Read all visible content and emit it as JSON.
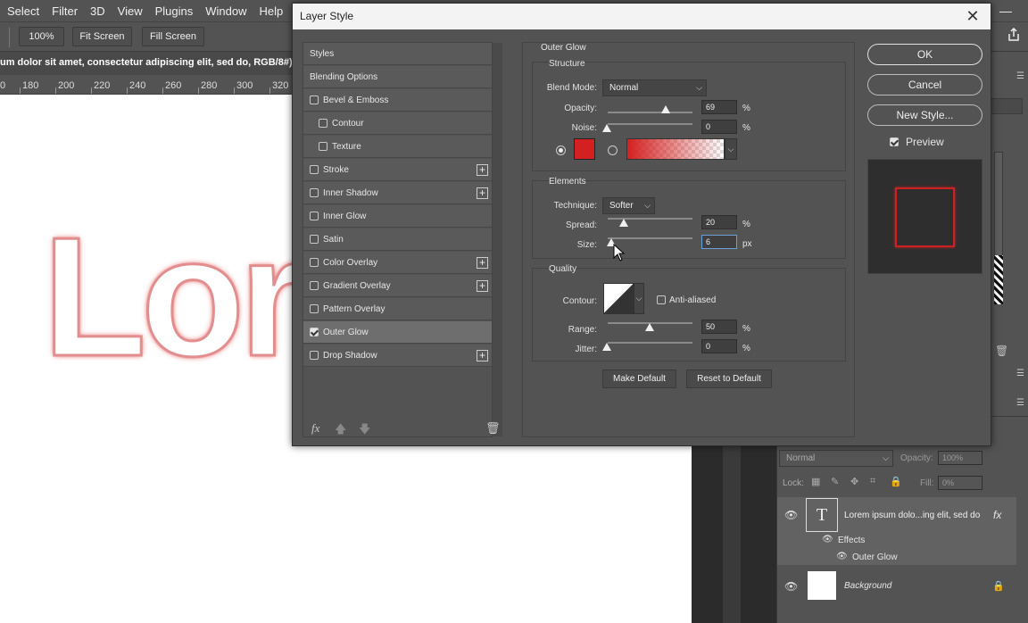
{
  "menu": [
    "Select",
    "Filter",
    "3D",
    "View",
    "Plugins",
    "Window",
    "Help"
  ],
  "options_bar": {
    "zoom": "100%",
    "fit_screen": "Fit Screen",
    "fill_screen": "Fill Screen"
  },
  "document_tab": "um dolor sit amet, consectetur adipiscing elit, sed do, RGB/8#) *",
  "ruler": [
    "0",
    "180",
    "200",
    "220",
    "240",
    "260",
    "280",
    "300",
    "320"
  ],
  "canvas_text": "Lor",
  "dialog": {
    "title": "Layer Style",
    "close": "✕",
    "styles": [
      {
        "label": "Styles",
        "checkbox": null,
        "plus": false,
        "indent": false,
        "selected": false
      },
      {
        "label": "Blending Options",
        "checkbox": null,
        "plus": false,
        "indent": false,
        "selected": false
      },
      {
        "label": "Bevel & Emboss",
        "checkbox": false,
        "plus": false,
        "indent": false,
        "selected": false
      },
      {
        "label": "Contour",
        "checkbox": false,
        "plus": false,
        "indent": true,
        "selected": false
      },
      {
        "label": "Texture",
        "checkbox": false,
        "plus": false,
        "indent": true,
        "selected": false
      },
      {
        "label": "Stroke",
        "checkbox": false,
        "plus": true,
        "indent": false,
        "selected": false
      },
      {
        "label": "Inner Shadow",
        "checkbox": false,
        "plus": true,
        "indent": false,
        "selected": false
      },
      {
        "label": "Inner Glow",
        "checkbox": false,
        "plus": false,
        "indent": false,
        "selected": false
      },
      {
        "label": "Satin",
        "checkbox": false,
        "plus": false,
        "indent": false,
        "selected": false
      },
      {
        "label": "Color Overlay",
        "checkbox": false,
        "plus": true,
        "indent": false,
        "selected": false
      },
      {
        "label": "Gradient Overlay",
        "checkbox": false,
        "plus": true,
        "indent": false,
        "selected": false
      },
      {
        "label": "Pattern Overlay",
        "checkbox": false,
        "plus": false,
        "indent": false,
        "selected": false
      },
      {
        "label": "Outer Glow",
        "checkbox": true,
        "plus": false,
        "indent": false,
        "selected": true
      },
      {
        "label": "Drop Shadow",
        "checkbox": false,
        "plus": true,
        "indent": false,
        "selected": false
      }
    ],
    "footer_fx": "fx",
    "section_title": "Outer Glow",
    "structure": {
      "title": "Structure",
      "blend_mode_label": "Blend Mode:",
      "blend_mode": "Normal",
      "opacity_label": "Opacity:",
      "opacity": "69",
      "noise_label": "Noise:",
      "noise": "0",
      "percent": "%",
      "glow_color": "#d42020"
    },
    "elements": {
      "title": "Elements",
      "technique_label": "Technique:",
      "technique": "Softer",
      "spread_label": "Spread:",
      "spread": "20",
      "size_label": "Size:",
      "size": "6",
      "px": "px",
      "percent": "%"
    },
    "quality": {
      "title": "Quality",
      "contour_label": "Contour:",
      "anti_aliased": "Anti-aliased",
      "range_label": "Range:",
      "range": "50",
      "jitter_label": "Jitter:",
      "jitter": "0",
      "percent": "%"
    },
    "make_default": "Make Default",
    "reset_default": "Reset to Default",
    "ok": "OK",
    "cancel": "Cancel",
    "new_style": "New Style...",
    "preview": "Preview"
  },
  "layers": {
    "blend": "Normal",
    "opacity_label": "Opacity:",
    "opacity": "100%",
    "lock_label": "Lock:",
    "fill_label": "Fill:",
    "fill": "0%",
    "text_layer": "Lorem ipsum dolo...ing elit, sed do",
    "effects": "Effects",
    "outer_glow": "Outer Glow",
    "background": "Background",
    "fx": "fx"
  }
}
